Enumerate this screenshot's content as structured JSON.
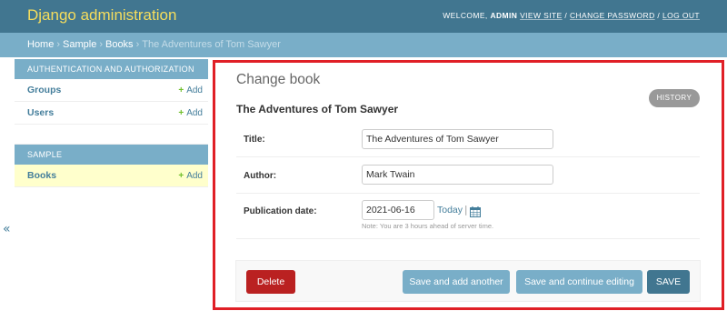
{
  "header": {
    "brand": "Django administration",
    "welcome": "WELCOME,",
    "username": "ADMIN",
    "view_site": "VIEW SITE",
    "change_password": "CHANGE PASSWORD",
    "log_out": "LOG OUT",
    "separator": "/"
  },
  "breadcrumbs": {
    "home": "Home",
    "app": "Sample",
    "model": "Books",
    "current": "The Adventures of Tom Sawyer",
    "separator": "›"
  },
  "sidebar": {
    "modules": [
      {
        "caption": "AUTHENTICATION AND AUTHORIZATION",
        "items": [
          {
            "label": "Groups",
            "add": "Add"
          },
          {
            "label": "Users",
            "add": "Add"
          }
        ]
      },
      {
        "caption": "SAMPLE",
        "items": [
          {
            "label": "Books",
            "add": "Add"
          }
        ]
      }
    ],
    "collapse_glyph": "«"
  },
  "content": {
    "title": "Change book",
    "history": "HISTORY",
    "object_title": "The Adventures of Tom Sawyer",
    "fields": {
      "title": {
        "label": "Title:",
        "value": "The Adventures of Tom Sawyer"
      },
      "author": {
        "label": "Author:",
        "value": "Mark Twain"
      },
      "publication_date": {
        "label": "Publication date:",
        "value": "2021-06-16",
        "today": "Today",
        "pipe": "|",
        "help": "Note: You are 3 hours ahead of server time."
      }
    },
    "buttons": {
      "delete": "Delete",
      "save_add_another": "Save and add another",
      "save_continue": "Save and continue editing",
      "save": "SAVE"
    }
  },
  "colors": {
    "header_bg": "#417690",
    "brand": "#f5dd5d",
    "breadcrumbs_bg": "#79aec8",
    "link": "#447e9b",
    "add_plus": "#70bf2b",
    "delete": "#ba2121",
    "highlight_border": "#e01f26",
    "active_row": "#ffffcc"
  },
  "icons": {
    "add": "plus-icon",
    "calendar": "calendar-icon",
    "collapse": "collapse-sidebar-icon"
  }
}
